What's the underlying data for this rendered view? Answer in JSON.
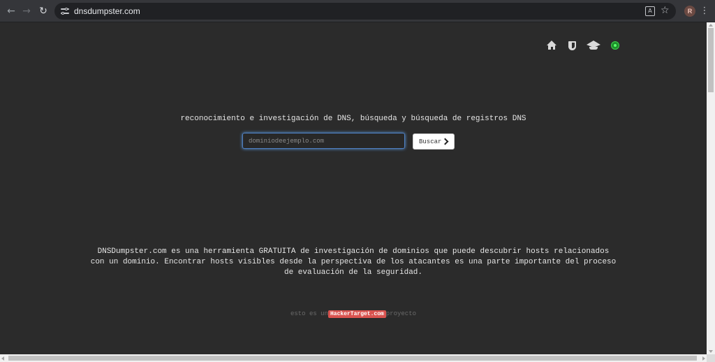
{
  "browser": {
    "url": "dnsdumpster.com",
    "back_icon": "←",
    "forward_icon": "→",
    "reload_icon": "↻",
    "translate_icon": "A",
    "star_icon": "☆",
    "avatar_letter": "R",
    "menu_icon": "⋮"
  },
  "header_icons": [
    "home-icon",
    "shield-icon",
    "graduation-cap-icon",
    "status-icon"
  ],
  "main": {
    "tagline": "reconocimiento e investigación de DNS, búsqueda y búsqueda de registros DNS",
    "search": {
      "placeholder": "dominiodeejemplo.com",
      "value": "",
      "button_label": "Buscar"
    },
    "description": "DNSDumpster.com es una herramienta GRATUITA de investigación de dominios que puede descubrir hosts relacionados con un dominio. Encontrar hosts visibles desde la perspectiva de los atacantes es una parte importante del proceso de evaluación de la seguridad.",
    "footer": {
      "prefix": "esto es un",
      "badge": "HackerTarget.com",
      "suffix": "proyecto"
    }
  },
  "colors": {
    "page_background": "#2b2b2b",
    "badge": "#d9534f",
    "status_green": "#3fd04c",
    "input_focus": "#5b9be0"
  }
}
